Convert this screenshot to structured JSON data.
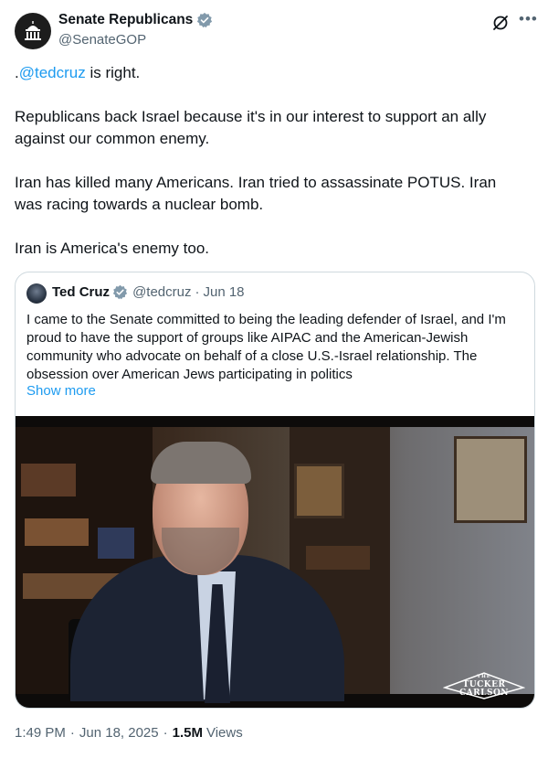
{
  "author": {
    "display_name": "Senate Republicans",
    "handle": "@SenateGOP"
  },
  "tweet": {
    "mention": "@tedcruz",
    "line1_prefix": ".",
    "line1_suffix": " is right.",
    "paragraph2": "Republicans back Israel because it's in our interest to support an ally against our common enemy.",
    "paragraph3": "Iran has killed many Americans. Iran tried to assassinate POTUS. Iran was racing towards a nuclear bomb.",
    "paragraph4": "Iran is America's enemy too."
  },
  "quote": {
    "display_name": "Ted Cruz",
    "handle": "@tedcruz",
    "separator": "·",
    "date": "Jun 18",
    "text": "I came to the Senate committed to being the leading defender of Israel, and I'm proud to have the support of groups like AIPAC and the American-Jewish community who advocate on behalf of a close U.S.-Israel relationship. The obsession over American Jews participating in politics",
    "show_more": "Show more",
    "video_watermark": [
      "THE",
      "TUCKER",
      "CARLSON"
    ]
  },
  "meta": {
    "time": "1:49 PM",
    "separator": "·",
    "date": "Jun 18, 2025",
    "views_count": "1.5M",
    "views_label": "Views"
  },
  "colors": {
    "link": "#1d9bf0",
    "secondary_text": "#536471",
    "verified_badge": "#829aab"
  },
  "icons": [
    "capitol-icon",
    "verified-badge-icon",
    "grok-icon",
    "more-icon"
  ]
}
